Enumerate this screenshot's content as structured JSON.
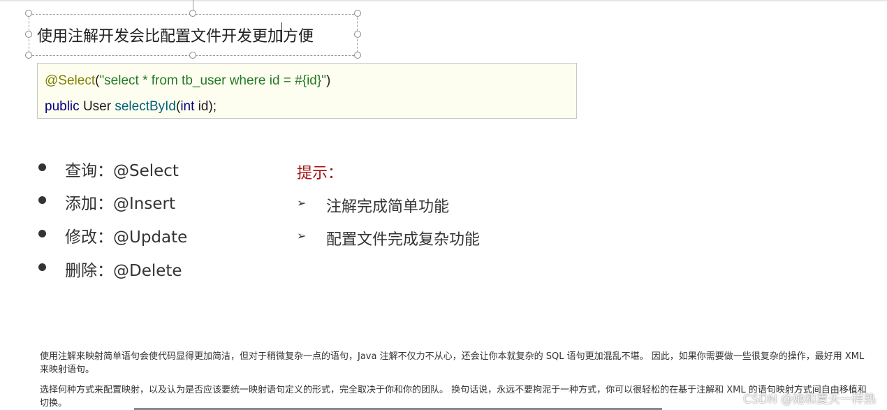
{
  "title": "使用注解开发会比配置文件开发更加方便",
  "code": {
    "line1": {
      "annotation": "@Select",
      "open": "(",
      "string": "\"select * from tb_user where id = #{id}\"",
      "close": ")"
    },
    "line2": {
      "public": "public",
      "type": "User",
      "method": "selectById",
      "open": "(",
      "param_type": "int",
      "param": " id",
      "close": ");"
    }
  },
  "bullets": [
    "查询：@Select",
    "添加：@Insert",
    "修改：@Update",
    "删除：@Delete"
  ],
  "tips": {
    "title": "提示：",
    "items": [
      "注解完成简单功能",
      "配置文件完成复杂功能"
    ]
  },
  "notes": [
    "使用注解来映射简单语句会使代码显得更加简洁，但对于稍微复杂一点的语句，Java 注解不仅力不从心，还会让你本就复杂的 SQL 语句更加混乱不堪。 因此，如果你需要做一些很复杂的操作，最好用 XML 来映射语句。",
    "选择何种方式来配置映射，以及认为是否应该要统一映射语句定义的形式，完全取决于你和你的团队。 换句话说，永远不要拘泥于一种方式，你可以很轻松的在基于注解和 XML 的语句映射方式间自由移植和切换。"
  ],
  "watermark": "CSDN @她和夏天一样热",
  "icons": {
    "bullet": "filled-circle",
    "tip_arrow": "arrowhead-right"
  },
  "colors": {
    "tips_title": "#a50f0f",
    "annotation": "#808000",
    "string": "#237a23",
    "keyword": "#000080",
    "method": "#00627a",
    "code_bg": "#fefef0"
  }
}
